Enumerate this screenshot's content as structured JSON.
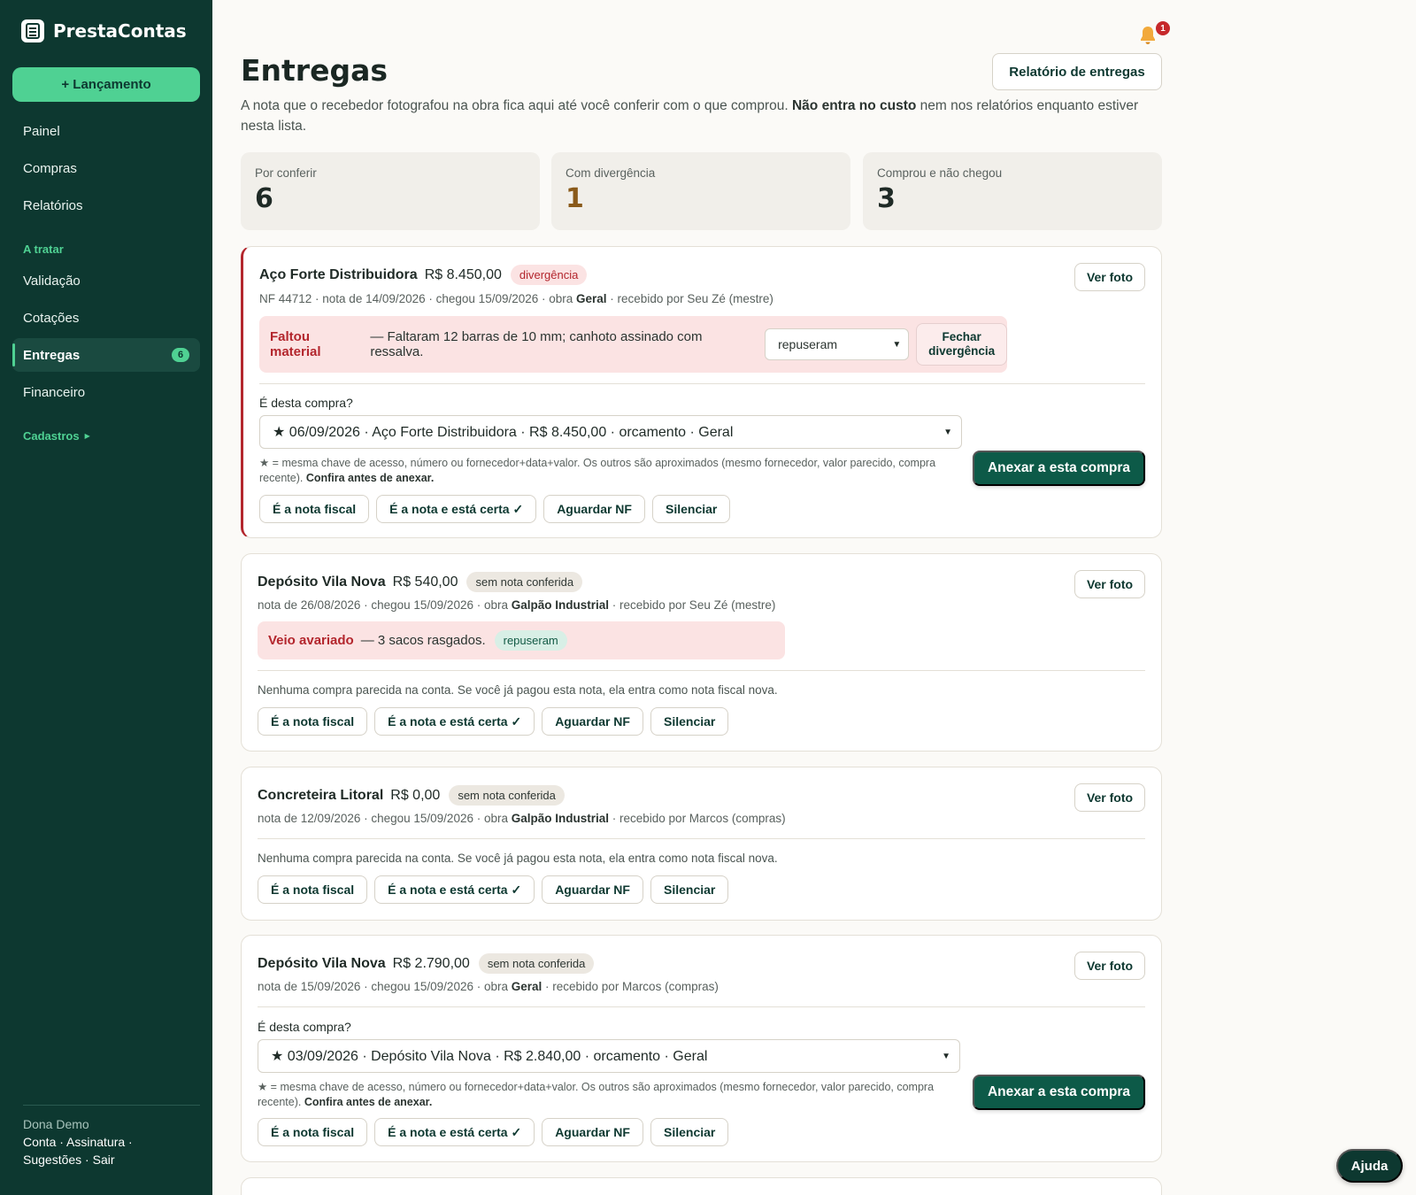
{
  "brand": {
    "name": "PrestaContas"
  },
  "sidebar": {
    "new_button": "+ Lançamento",
    "items": [
      {
        "label": "Painel"
      },
      {
        "label": "Compras"
      },
      {
        "label": "Relatórios"
      }
    ],
    "section_label": "A tratar",
    "section_items": [
      {
        "label": "Validação"
      },
      {
        "label": "Cotações"
      },
      {
        "label": "Entregas",
        "badge": "6"
      },
      {
        "label": "Financeiro"
      }
    ],
    "cadastros": "Cadastros",
    "footer": {
      "user": "Dona Demo",
      "line1": "Conta · Assinatura ·",
      "line2": "Sugestões · Sair"
    }
  },
  "header": {
    "notif_count": "1",
    "title": "Entregas",
    "report_button": "Relatório de entregas",
    "intro_a": "A nota que o recebedor fotografou na obra fica aqui até você conferir com o que comprou. ",
    "intro_b": "Não entra no custo",
    "intro_c": " nem nos relatórios enquanto estiver nesta lista."
  },
  "stats": [
    {
      "label": "Por conferir",
      "value": "6"
    },
    {
      "label": "Com divergência",
      "value": "1"
    },
    {
      "label": "Comprou e não chegou",
      "value": "3"
    }
  ],
  "common": {
    "photo_button": "Ver foto",
    "question": "É desta compra?",
    "hint_a": "★ = mesma chave de acesso, número ou fornecedor+data+valor. Os outros são aproximados (mesmo fornecedor, valor parecido, compra recente). ",
    "hint_b": "Confira antes de anexar.",
    "attach_button": "Anexar a esta compra",
    "no_match": "Nenhuma compra parecida na conta. Se você já pagou esta nota, ela entra como nota fiscal nova.",
    "actions": [
      "É a nota fiscal",
      "É a nota e está certa ✓",
      "Aguardar NF",
      "Silenciar"
    ]
  },
  "cards": [
    {
      "supplier": "Aço Forte Distribuidora",
      "amount": "R$ 8.450,00",
      "tag": "divergência",
      "meta_a": "NF 44712 · nota de 14/09/2026 · chegou 15/09/2026 · obra ",
      "obra": "Geral",
      "meta_b": " · recebido por Seu Zé (mestre)",
      "problem_kind": "Faltou material",
      "problem_text": "— Faltaram 12 barras de 10 mm; canhoto assinado com ressalva.",
      "resolution": "repuseram",
      "close_button": "Fechar divergência",
      "purchase": "★ 06/09/2026 · Aço Forte Distribuidora · R$ 8.450,00 · orcamento · Geral"
    },
    {
      "supplier": "Depósito Vila Nova",
      "amount": "R$ 540,00",
      "tag": "sem nota conferida",
      "meta_a": "nota de 26/08/2026 · chegou 15/09/2026 · obra ",
      "obra": "Galpão Industrial",
      "meta_b": " · recebido por Seu Zé (mestre)",
      "problem_kind": "Veio avariado",
      "problem_text": "— 3 sacos rasgados.",
      "resolution_tag": "repuseram"
    },
    {
      "supplier": "Concreteira Litoral",
      "amount": "R$ 0,00",
      "tag": "sem nota conferida",
      "meta_a": "nota de 12/09/2026 · chegou 15/09/2026 · obra ",
      "obra": "Galpão Industrial",
      "meta_b": " · recebido por Marcos (compras)"
    },
    {
      "supplier": "Depósito Vila Nova",
      "amount": "R$ 2.790,00",
      "tag": "sem nota conferida",
      "meta_a": "nota de 15/09/2026 · chegou 15/09/2026 · obra ",
      "obra": "Geral",
      "meta_b": " · recebido por Marcos (compras)",
      "purchase": "★ 03/09/2026 · Depósito Vila Nova · R$ 2.840,00 · orcamento · Geral"
    }
  ],
  "help_button": "Ajuda",
  "colors": {
    "sidebar": "#0d3830",
    "accent": "#4fd193",
    "primary_button": "#0d5a48",
    "alert": "#b3262d"
  }
}
